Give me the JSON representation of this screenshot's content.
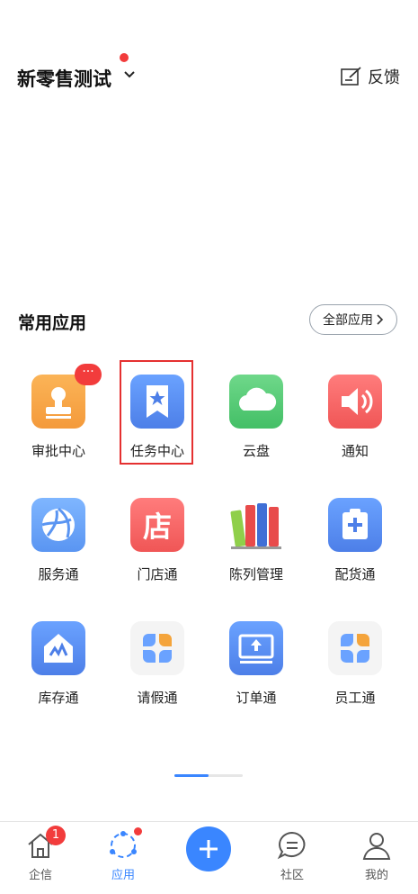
{
  "header": {
    "org_name": "新零售测试",
    "feedback_label": "反馈"
  },
  "section": {
    "title": "常用应用",
    "all_apps_label": "全部应用"
  },
  "apps": [
    {
      "label": "审批中心",
      "badge": "···"
    },
    {
      "label": "任务中心"
    },
    {
      "label": "云盘"
    },
    {
      "label": "通知"
    },
    {
      "label": "服务通"
    },
    {
      "label": "门店通",
      "icon_text": "店"
    },
    {
      "label": "陈列管理"
    },
    {
      "label": "配货通"
    },
    {
      "label": "库存通"
    },
    {
      "label": "请假通"
    },
    {
      "label": "订单通"
    },
    {
      "label": "员工通"
    }
  ],
  "tabbar": {
    "tabs": [
      {
        "label": "企信",
        "badge": "1"
      },
      {
        "label": "应用"
      },
      {
        "label": "社区"
      },
      {
        "label": "我的"
      }
    ]
  },
  "colors": {
    "accent": "#3a86ff",
    "badge": "#f23c3c",
    "highlight": "#e53030"
  }
}
